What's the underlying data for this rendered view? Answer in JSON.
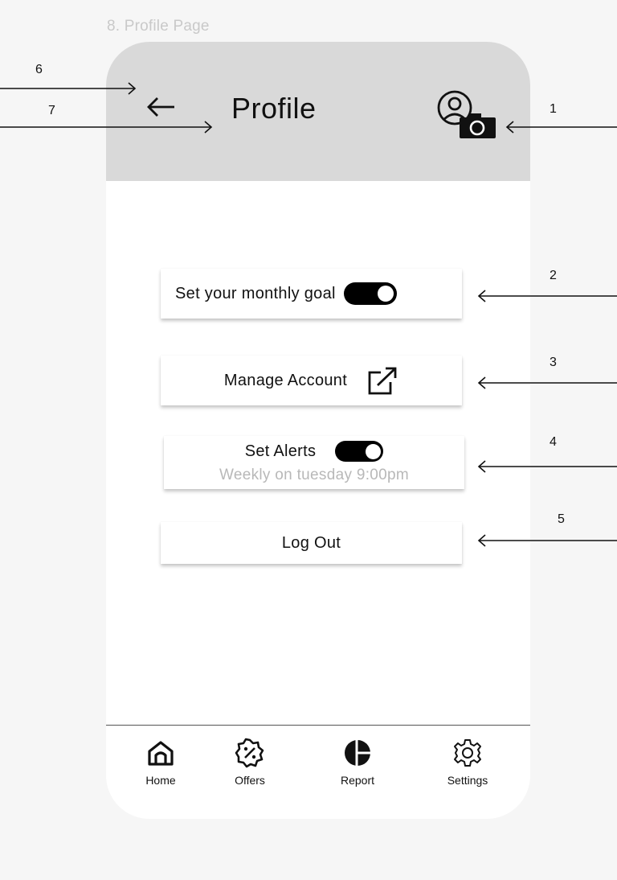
{
  "caption": "8. Profile Page",
  "header": {
    "title": "Profile",
    "background": "#d9d9d9"
  },
  "cards": {
    "goal_label": "Set your monthly goal",
    "goal_toggle_on": true,
    "manage_label": "Manage Account",
    "alerts_label": "Set Alerts",
    "alerts_toggle_on": true,
    "alerts_schedule": "Weekly on tuesday 9:00pm",
    "logout_label": "Log Out"
  },
  "nav": [
    {
      "label": "Home",
      "icon": "home-icon"
    },
    {
      "label": "Offers",
      "icon": "offers-icon"
    },
    {
      "label": "Report",
      "icon": "report-icon"
    },
    {
      "label": "Settings",
      "icon": "settings-icon"
    }
  ],
  "annotations": [
    "1",
    "2",
    "3",
    "4",
    "5",
    "6",
    "7"
  ]
}
